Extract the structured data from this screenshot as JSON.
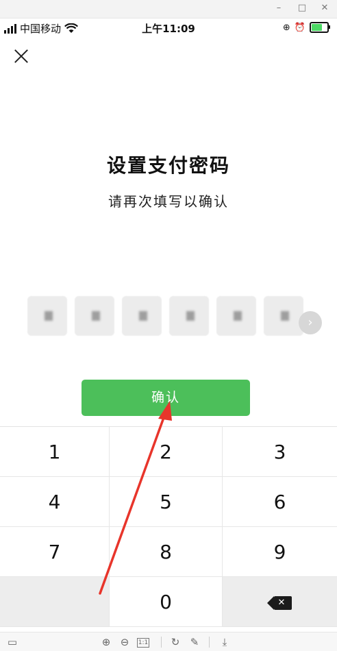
{
  "window": {
    "minimize": "–",
    "maximize": "□",
    "close": "✕"
  },
  "status": {
    "carrier": "中国移动",
    "time": "上午11:09"
  },
  "page": {
    "title": "设置支付密码",
    "subtitle": "请再次填写以确认",
    "confirm_label": "确认",
    "password_digits_entered": 6
  },
  "keypad": {
    "rows": [
      [
        "1",
        "2",
        "3"
      ],
      [
        "4",
        "5",
        "6"
      ],
      [
        "7",
        "8",
        "9"
      ],
      [
        "",
        "0",
        "backspace"
      ]
    ]
  },
  "viewer_toolbar": {
    "icons": [
      "panel-icon",
      "zoom-in-icon",
      "zoom-out-icon",
      "actual-size-icon",
      "rotate-icon",
      "edit-icon",
      "download-icon"
    ],
    "actual_size_label": "1:1"
  },
  "colors": {
    "accent_green": "#4cbf5a",
    "annotation_arrow": "#e8352b"
  }
}
